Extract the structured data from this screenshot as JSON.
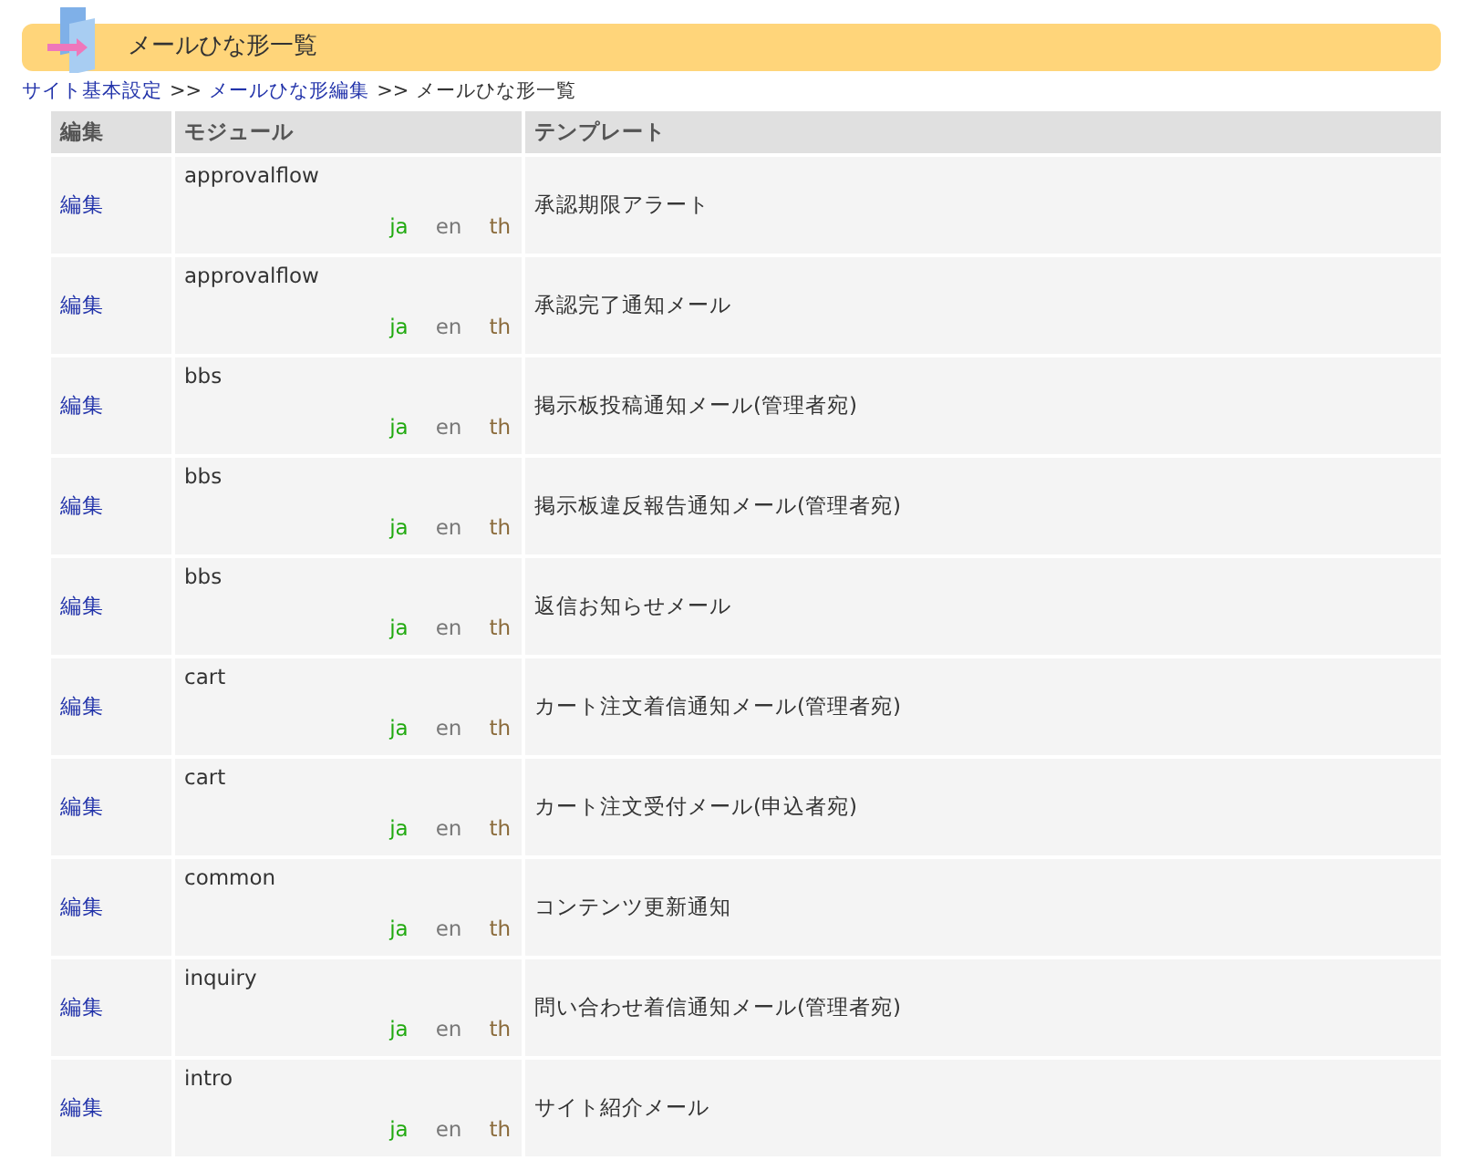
{
  "page_title": "メールひな形一覧",
  "breadcrumb": [
    {
      "label": "サイト基本設定",
      "link": true
    },
    {
      "label": ">>",
      "link": false
    },
    {
      "label": "メールひな形編集",
      "link": true
    },
    {
      "label": ">>",
      "link": false
    },
    {
      "label": "メールひな形一覧",
      "link": false
    }
  ],
  "table": {
    "columns": [
      "編集",
      "モジュール",
      "テンプレート"
    ],
    "rows": [
      {
        "edit": "編集",
        "module": "approvalflow",
        "languages": [
          {
            "code": "ja",
            "color": "#22aa11"
          },
          {
            "code": "en",
            "color": "#777777"
          },
          {
            "code": "th",
            "color": "#8a6a3a"
          }
        ],
        "template": "承認期限アラート"
      },
      {
        "edit": "編集",
        "module": "approvalflow",
        "languages": [
          {
            "code": "ja",
            "color": "#22aa11"
          },
          {
            "code": "en",
            "color": "#777777"
          },
          {
            "code": "th",
            "color": "#8a6a3a"
          }
        ],
        "template": "承認完了通知メール"
      },
      {
        "edit": "編集",
        "module": "bbs",
        "languages": [
          {
            "code": "ja",
            "color": "#22aa11"
          },
          {
            "code": "en",
            "color": "#777777"
          },
          {
            "code": "th",
            "color": "#8a6a3a"
          }
        ],
        "template": "掲示板投稿通知メール(管理者宛)"
      },
      {
        "edit": "編集",
        "module": "bbs",
        "languages": [
          {
            "code": "ja",
            "color": "#22aa11"
          },
          {
            "code": "en",
            "color": "#777777"
          },
          {
            "code": "th",
            "color": "#8a6a3a"
          }
        ],
        "template": "掲示板違反報告通知メール(管理者宛)"
      },
      {
        "edit": "編集",
        "module": "bbs",
        "languages": [
          {
            "code": "ja",
            "color": "#22aa11"
          },
          {
            "code": "en",
            "color": "#777777"
          },
          {
            "code": "th",
            "color": "#8a6a3a"
          }
        ],
        "template": "返信お知らせメール"
      },
      {
        "edit": "編集",
        "module": "cart",
        "languages": [
          {
            "code": "ja",
            "color": "#22aa11"
          },
          {
            "code": "en",
            "color": "#777777"
          },
          {
            "code": "th",
            "color": "#8a6a3a"
          }
        ],
        "template": "カート注文着信通知メール(管理者宛)"
      },
      {
        "edit": "編集",
        "module": "cart",
        "languages": [
          {
            "code": "ja",
            "color": "#22aa11"
          },
          {
            "code": "en",
            "color": "#777777"
          },
          {
            "code": "th",
            "color": "#8a6a3a"
          }
        ],
        "template": "カート注文受付メール(申込者宛)"
      },
      {
        "edit": "編集",
        "module": "common",
        "languages": [
          {
            "code": "ja",
            "color": "#22aa11"
          },
          {
            "code": "en",
            "color": "#777777"
          },
          {
            "code": "th",
            "color": "#8a6a3a"
          }
        ],
        "template": "コンテンツ更新通知"
      },
      {
        "edit": "編集",
        "module": "inquiry",
        "languages": [
          {
            "code": "ja",
            "color": "#22aa11"
          },
          {
            "code": "en",
            "color": "#777777"
          },
          {
            "code": "th",
            "color": "#8a6a3a"
          }
        ],
        "template": "問い合わせ着信通知メール(管理者宛)"
      },
      {
        "edit": "編集",
        "module": "intro",
        "languages": [
          {
            "code": "ja",
            "color": "#22aa11"
          },
          {
            "code": "en",
            "color": "#777777"
          },
          {
            "code": "th",
            "color": "#8a6a3a"
          }
        ],
        "template": "サイト紹介メール"
      }
    ]
  }
}
